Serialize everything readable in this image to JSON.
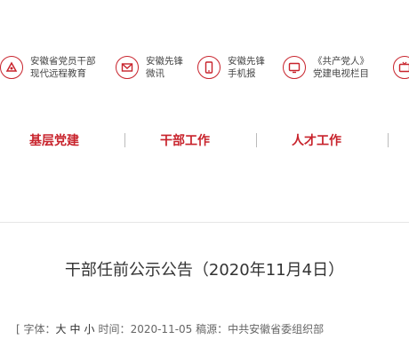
{
  "quick_links": [
    {
      "line1": "安徽省党员干部",
      "line2": "现代远程教育",
      "icon": "broadcast-icon"
    },
    {
      "line1": "安徽先锋",
      "line2": "微讯",
      "icon": "mail-icon"
    },
    {
      "line1": "安徽先锋",
      "line2": "手机报",
      "icon": "mobile-icon"
    },
    {
      "line1": "《共产党人》",
      "line2": "党建电视栏目",
      "icon": "tv-icon"
    }
  ],
  "nav": {
    "items": [
      {
        "label": "基层党建"
      },
      {
        "label": "干部工作"
      },
      {
        "label": "人才工作"
      }
    ]
  },
  "article": {
    "title": "干部任前公示公告（2020年11月4日）",
    "meta_prefix": "[ 字体：",
    "size_large": "大",
    "size_medium": "中",
    "size_small": "小",
    "time_label": "时间：",
    "time_value": "2020-11-05",
    "source_label": "稿源：",
    "source_value": "中共安徽省委组织部"
  },
  "colors": {
    "accent": "#c8232c"
  }
}
